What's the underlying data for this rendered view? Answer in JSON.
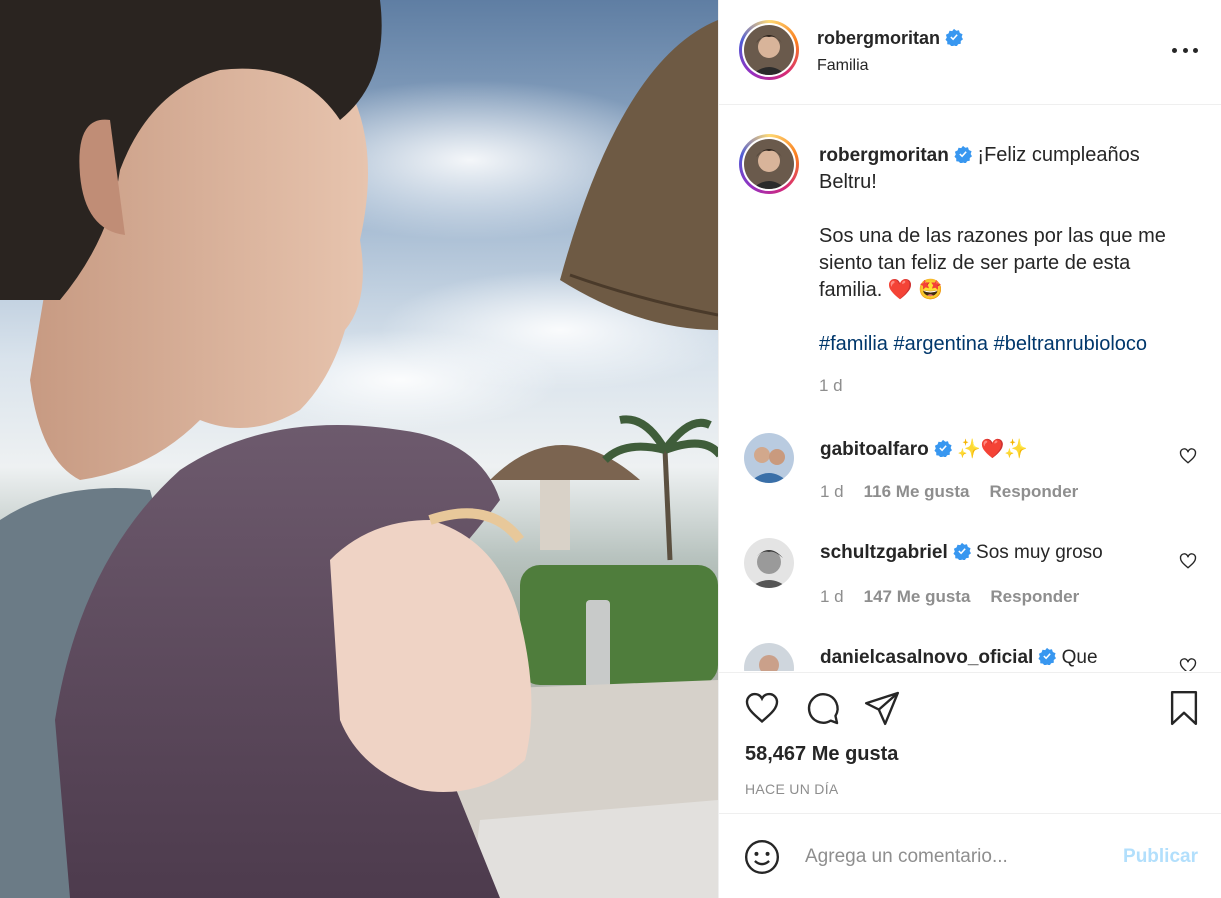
{
  "post": {
    "username": "robergmoritan",
    "location": "Familia",
    "caption_first": "¡Feliz cumpleaños Beltru!",
    "caption_body": "Sos una de las razones por las que me siento tan feliz de ser parte de esta familia.",
    "caption_emoji": "❤️ 🤩",
    "hashtags": [
      "#familia",
      "#argentina",
      "#beltranrubioloco"
    ],
    "caption_time": "1 d",
    "likes": "58,467 Me gusta",
    "posted": "HACE UN DÍA"
  },
  "comments": [
    {
      "username": "gabitoalfaro",
      "text": "✨❤️✨",
      "time": "1 d",
      "likes": "116 Me gusta",
      "reply": "Responder"
    },
    {
      "username": "schultzgabriel",
      "text": "Sos muy groso",
      "time": "1 d",
      "likes": "147 Me gusta",
      "reply": "Responder"
    },
    {
      "username": "danielcasalnovo_oficial",
      "text": "Que",
      "time": "",
      "likes": "",
      "reply": ""
    }
  ],
  "add_comment": {
    "placeholder": "Agrega un comentario...",
    "publish_label": "Publicar"
  },
  "icons": {
    "more": "more-options-icon",
    "like": "heart-icon",
    "comment": "comment-icon",
    "share": "paper-plane-icon",
    "save": "bookmark-icon",
    "emoji": "smiley-icon",
    "verified": "verified-badge-icon"
  },
  "colors": {
    "link": "#00376b",
    "verified": "#3897f0",
    "publish_disabled": "#b2dffc",
    "muted": "#8e8e8e"
  }
}
